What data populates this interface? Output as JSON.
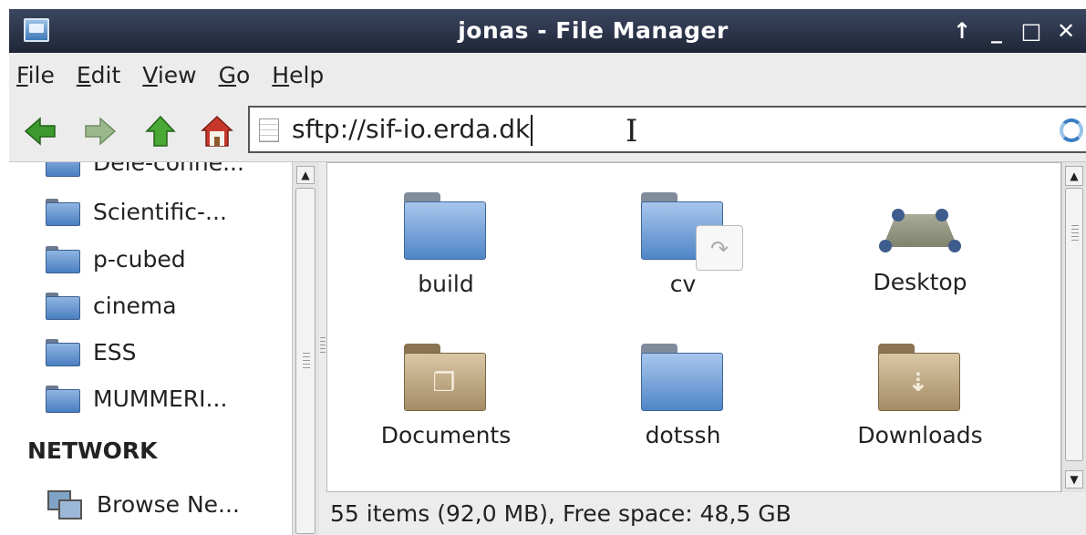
{
  "window": {
    "title": "jonas - File Manager",
    "controls": [
      "↑",
      "_",
      "□",
      "✕"
    ]
  },
  "menubar": [
    {
      "accel": "F",
      "rest": "ile"
    },
    {
      "accel": "E",
      "rest": "dit"
    },
    {
      "accel": "V",
      "rest": "iew"
    },
    {
      "accel": "G",
      "rest": "o"
    },
    {
      "accel": "H",
      "rest": "elp"
    }
  ],
  "toolbar": {
    "location": "sftp://sif-io.erda.dk",
    "accent_back": "#3c9a2e",
    "accent_home": "#c8372b"
  },
  "sidebar": {
    "partial_item": "Dele-conne...",
    "items": [
      {
        "label": "Scientific-..."
      },
      {
        "label": "p-cubed"
      },
      {
        "label": "cinema"
      },
      {
        "label": "ESS"
      },
      {
        "label": "MUMMERI..."
      }
    ],
    "network_heading": "NETWORK",
    "network_item": "Browse Ne..."
  },
  "files": [
    {
      "name": "build",
      "icon": "folder-icon"
    },
    {
      "name": "cv",
      "icon": "folder-link-icon"
    },
    {
      "name": "Desktop",
      "icon": "desktop-icon"
    },
    {
      "name": "Documents",
      "icon": "documents-folder-icon"
    },
    {
      "name": "dotssh",
      "icon": "folder-icon"
    },
    {
      "name": "Downloads",
      "icon": "downloads-folder-icon"
    }
  ],
  "status": "55 items (92,0 MB), Free space: 48,5 GB"
}
